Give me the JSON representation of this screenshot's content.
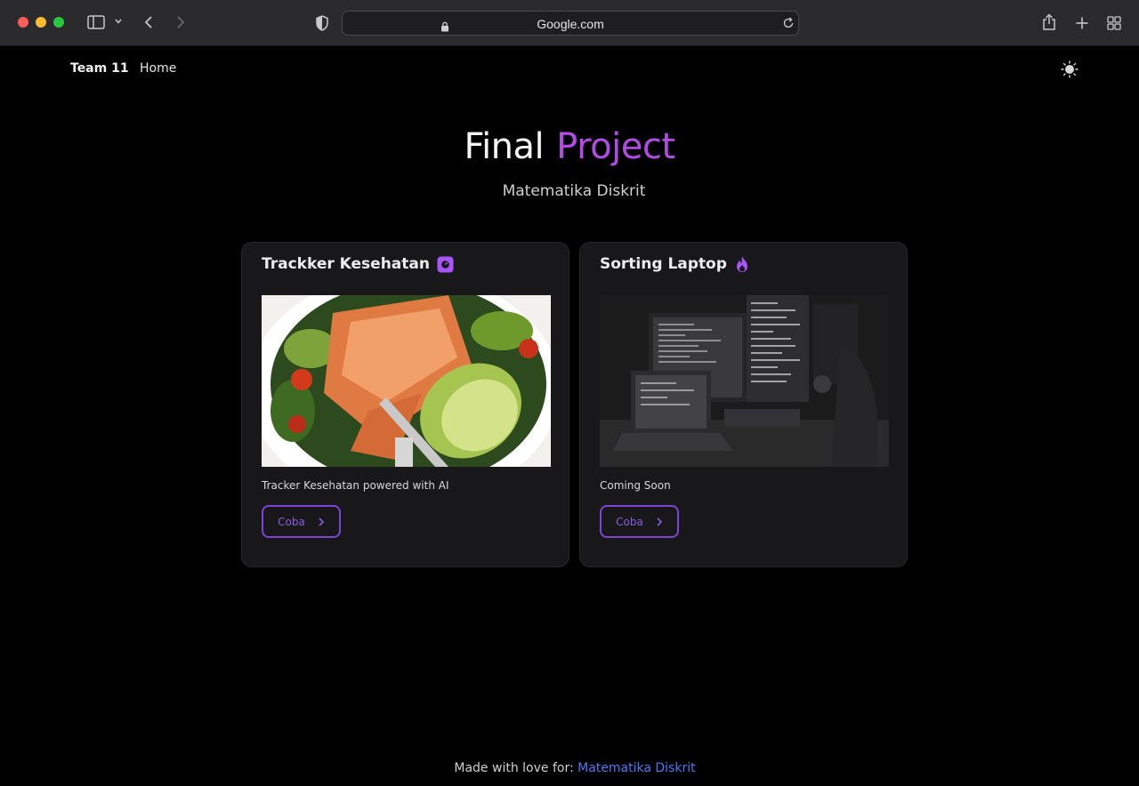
{
  "browser": {
    "url": "Google.com"
  },
  "nav": {
    "brand": "Team 11",
    "home": "Home"
  },
  "hero": {
    "title_part1": "Final",
    "title_part2": "Project",
    "subtitle": "Matematika Diskrit"
  },
  "cards": [
    {
      "title": "Trackker Kesehatan",
      "icon": "scale-icon",
      "description": "Tracker Kesehatan powered with AI",
      "button": "Coba"
    },
    {
      "title": "Sorting Laptop",
      "icon": "flame-icon",
      "description": "Coming Soon",
      "button": "Coba"
    }
  ],
  "footer": {
    "text": "Made with love for:",
    "link": "Matematika Diskrit"
  },
  "colors": {
    "accent": "#b24be6",
    "button_border": "#7c45d6",
    "link": "#4b7cf3",
    "background": "#000000",
    "card_bg": "#18181b"
  }
}
